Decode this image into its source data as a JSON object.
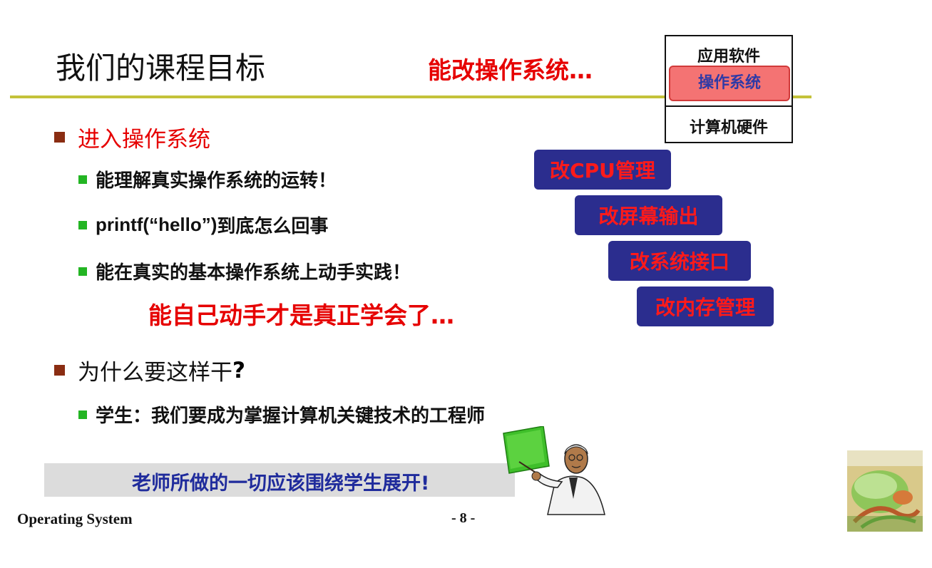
{
  "slide": {
    "title": "我们的课程目标",
    "title_accent": "能改操作系统…"
  },
  "os_stack": {
    "top": "应用软件",
    "middle": "操作系统",
    "bottom": "计算机硬件"
  },
  "bullets": {
    "section1": "进入操作系统",
    "item1": "能理解真实操作系统的运转！",
    "item2_bold": "printf(“hello”)",
    "item2_rest": "到底怎么回事",
    "item3": "能在真实的基本操作系统上动手实践！",
    "emphasis": "能自己动手才是真正学会了…",
    "section2_text": "为什么要这样干",
    "section2_q": "?",
    "item4_prefix": "学生：我们要成为",
    "item4_red": "掌握计算机关键技术的工程师"
  },
  "modifications": [
    "改CPU管理",
    "改屏幕输出",
    "改系统接口",
    "改内存管理"
  ],
  "banner": "老师所做的一切应该围绕学生展开!",
  "footer": {
    "course": "Operating System",
    "page": "- 8 -"
  },
  "colors": {
    "accent_red": "#e60000",
    "title_line": "#c4c23a",
    "box_blue": "#2b2d8e",
    "bullet_green": "#23b523",
    "bullet_brown": "#8a2d12"
  }
}
